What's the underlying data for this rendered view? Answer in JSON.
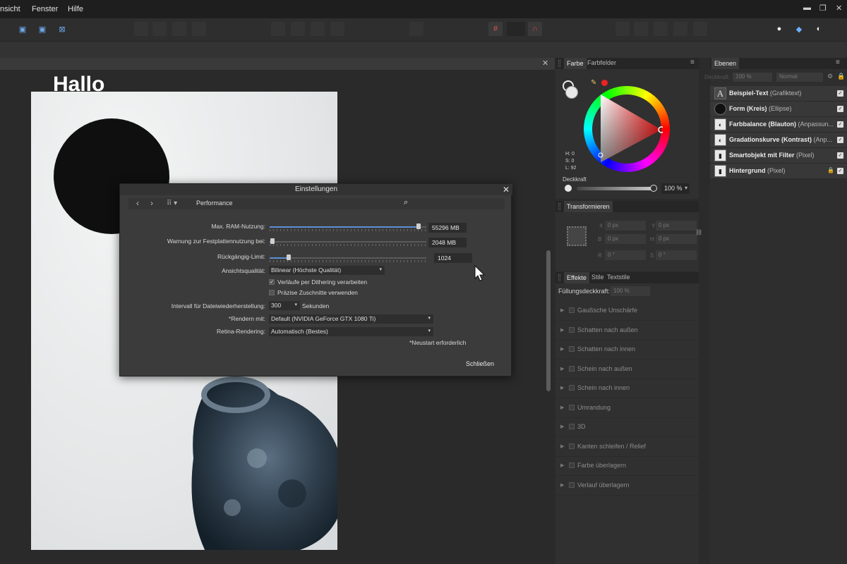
{
  "menu": {
    "items": [
      "nsicht",
      "Fenster",
      "Hilfe"
    ]
  },
  "document": {
    "canvas_text": "Hallo"
  },
  "panels": {
    "color": {
      "tabs": [
        "Farbe",
        "Farbfelder"
      ],
      "h": "H: 0",
      "s": "S: 0",
      "l": "L: 92",
      "opacity_label": "Deckkraft",
      "opacity_value": "100 %"
    },
    "transform": {
      "tab": "Transformieren",
      "x": "0 px",
      "y": "0 px",
      "w": "0 px",
      "h": "0 px",
      "r": "0 °",
      "s": "0 °"
    },
    "effects": {
      "tabs": [
        "Effekte",
        "Stile",
        "Textstile"
      ],
      "fill_opacity_label": "Füllungsdeckkraft:",
      "fill_opacity_value": "100 %",
      "items": [
        "Gaußsche Unschärfe",
        "Schatten nach außen",
        "Schatten nach innen",
        "Schein nach außen",
        "Schein nach innen",
        "Umrandung",
        "3D",
        "Kanten schleifen / Relief",
        "Farbe überlagern",
        "Verlauf überlagern"
      ]
    },
    "layers": {
      "tab": "Ebenen",
      "opacity_label": "Deckkraft:",
      "opacity": "100 %",
      "blend": "Normal",
      "items": [
        {
          "name": "Beispiel-Text",
          "type": "(Grafiktext)",
          "locked": false
        },
        {
          "name": "Form (Kreis)",
          "type": "(Ellipse)",
          "locked": false
        },
        {
          "name": "Farbbalance (Blauton)",
          "type": "(Anpassun...",
          "locked": false
        },
        {
          "name": "Gradationskurve (Kontrast)",
          "type": "(Anp...",
          "locked": false
        },
        {
          "name": "Smartobjekt mit Filter",
          "type": "(Pixel)",
          "locked": false
        },
        {
          "name": "Hintergrund",
          "type": "(Pixel)",
          "locked": true
        }
      ]
    }
  },
  "dialog": {
    "title": "Einstellungen",
    "section": "Performance",
    "ram_label": "Max. RAM-Nutzung:",
    "ram_value": "55296 MB",
    "ram_fraction": 0.95,
    "disk_label": "Warnung zur Festplattennutzung bei:",
    "disk_value": "2048 MB",
    "disk_fraction": 0.02,
    "undo_label": "Rückgängig-Limit:",
    "undo_value": "1024",
    "undo_fraction": 0.12,
    "quality_label": "Ansichtsqualität:",
    "quality_value": "Bilinear (Höchste Qualität)",
    "dither_label": "Verläufe per Dithering verarbeiten",
    "dither_checked": true,
    "precise_label": "Präzise Zuschnitte verwenden",
    "precise_checked": false,
    "interval_label": "Intervall für Dateiwiederherstellung:",
    "interval_value": "300",
    "interval_unit": "Sekunden",
    "render_label": "*Rendern mit:",
    "render_value": "Default (NVIDIA GeForce GTX 1080 Ti)",
    "retina_label": "Retina-Rendering:",
    "retina_value": "Automatisch (Bestes)",
    "restart_note": "*Neustart erforderlich",
    "close_label": "Schließen"
  }
}
